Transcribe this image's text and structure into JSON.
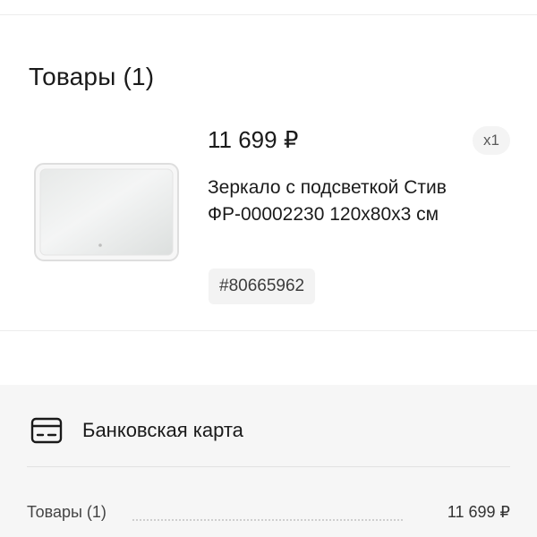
{
  "products": {
    "title": "Товары (1)",
    "item": {
      "price": "11 699 ₽",
      "quantity": "x1",
      "name": "Зеркало с подсветкой Стив ФР-00002230 120х80х3 см",
      "sku": "#80665962",
      "image_icon": "mirror-image"
    }
  },
  "payment": {
    "method_label": "Банковская карта",
    "icon": "credit-card-icon"
  },
  "summary": {
    "rows": [
      {
        "label": "Товары (1)",
        "value": "11 699 ₽"
      }
    ]
  }
}
